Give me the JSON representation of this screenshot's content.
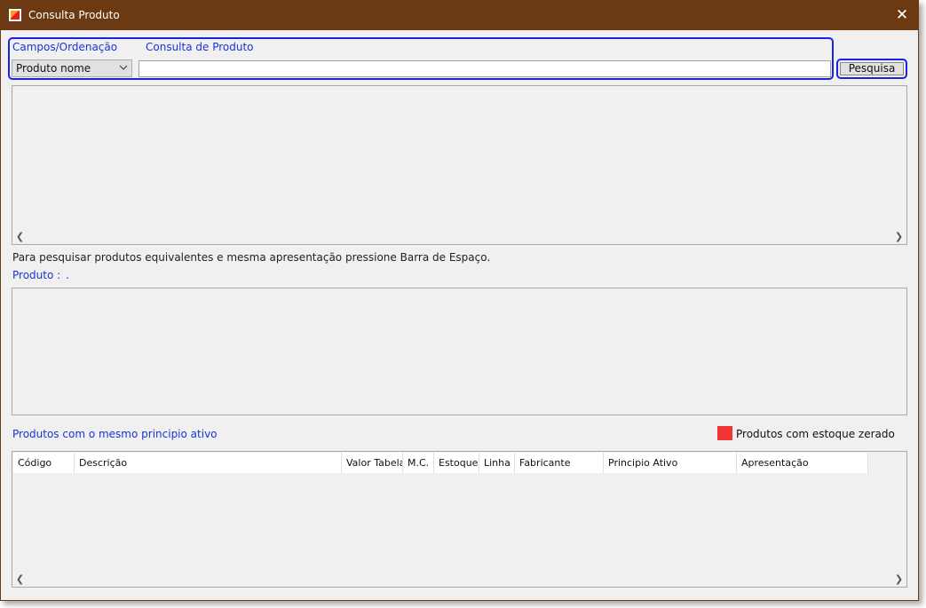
{
  "window": {
    "title": "Consulta Produto"
  },
  "search": {
    "fields_label": "Campos/Ordenação",
    "query_label": "Consulta de Produto",
    "field_selected": "Produto nome",
    "query_value": "",
    "button_label": "Pesquisa"
  },
  "info": {
    "hint": "Para pesquisar produtos equivalentes e mesma apresentação pressione Barra de Espaço.",
    "product_label": "Produto :",
    "product_value": "."
  },
  "similar": {
    "title": "Produtos com o mesmo principio ativo",
    "legend_label": "Produtos com estoque zerado",
    "legend_color": "#f03434",
    "columns": [
      "Código",
      "Descrição",
      "Valor Tabela",
      "M.C.",
      "Estoque",
      "Linha",
      "Fabricante",
      "Principio Ativo",
      "Apresentação"
    ]
  },
  "colors": {
    "titlebar": "#6b3a12",
    "accent_label": "#1a33d6",
    "highlight_border": "#1b22e0"
  },
  "icons": {
    "app": "app-logo-icon",
    "close": "close-icon",
    "dropdown": "chevron-down-icon",
    "scroll_left": "scroll-left-icon",
    "scroll_right": "scroll-right-icon"
  }
}
